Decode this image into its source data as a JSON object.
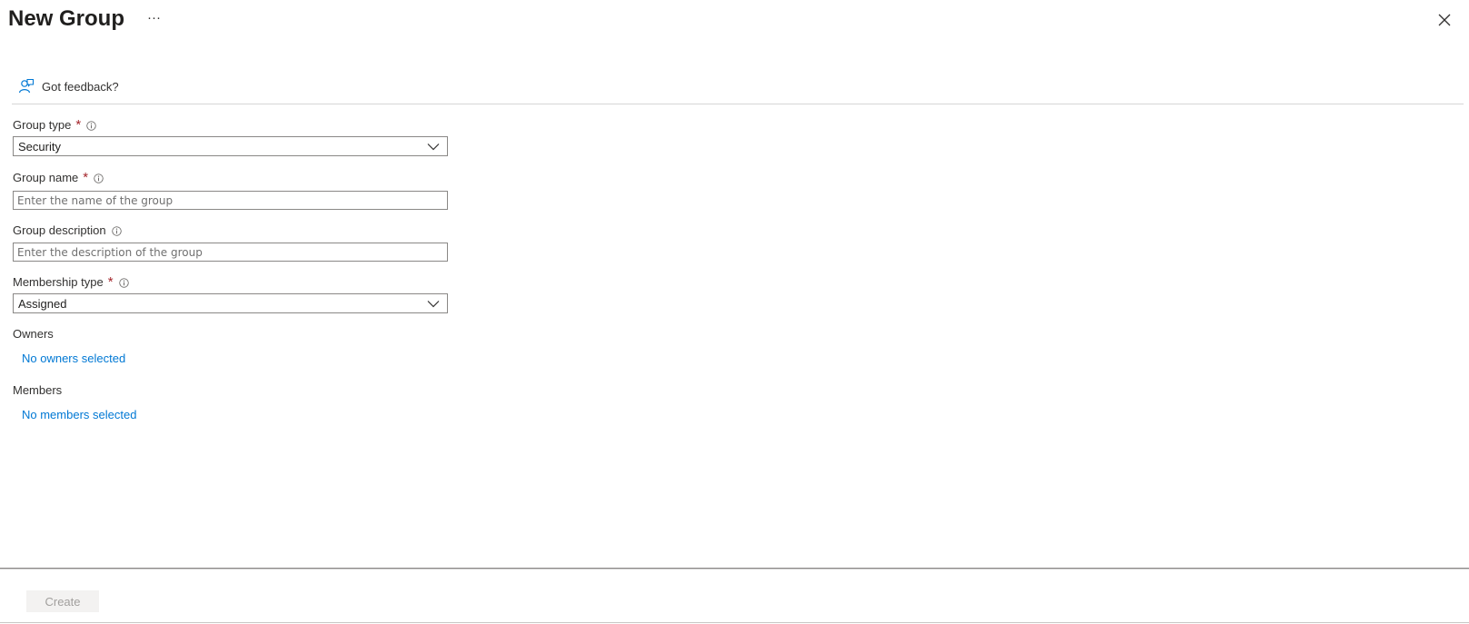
{
  "header": {
    "title": "New Group",
    "more_label": "···",
    "close_icon": "close-icon"
  },
  "feedback": {
    "label": "Got feedback?",
    "icon": "feedback-person-icon"
  },
  "form": {
    "group_type": {
      "label": "Group type",
      "required": "*",
      "value": "Security"
    },
    "group_name": {
      "label": "Group name",
      "required": "*",
      "value": "",
      "placeholder": "Enter the name of the group"
    },
    "group_description": {
      "label": "Group description",
      "value": "",
      "placeholder": "Enter the description of the group"
    },
    "membership_type": {
      "label": "Membership type",
      "required": "*",
      "value": "Assigned"
    },
    "owners": {
      "label": "Owners",
      "link": "No owners selected"
    },
    "members": {
      "label": "Members",
      "link": "No members selected"
    }
  },
  "footer": {
    "create_label": "Create"
  },
  "colors": {
    "accent": "#0078d4",
    "required": "#a4262c",
    "disabled_bg": "#f3f2f1",
    "disabled_text": "#a19f9d"
  }
}
